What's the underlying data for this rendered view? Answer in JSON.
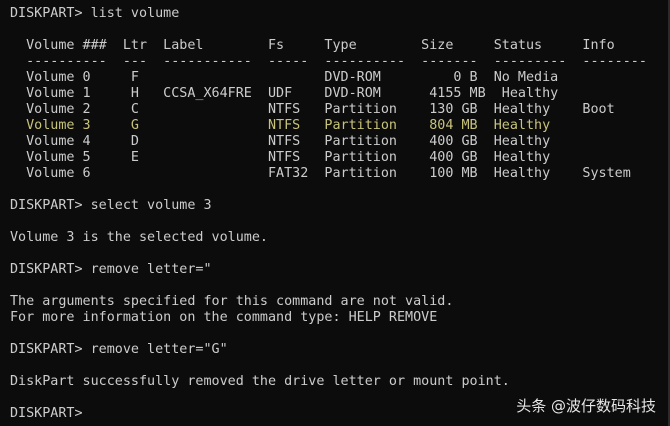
{
  "console": {
    "lines": [
      "DISKPART> list volume",
      "",
      "  Volume ###  Ltr  Label        Fs     Type        Size     Status     Info",
      "  ----------  ---  -----------  -----  ----------  -------  ---------  --------",
      "  Volume 0     F                       DVD-ROM         0 B  No Media",
      "  Volume 1     H   CCSA_X64FRE  UDF    DVD-ROM      4155 MB  Healthy",
      "  Volume 2     C                NTFS   Partition    130 GB  Healthy    Boot",
      "  Volume 3     G                NTFS   Partition    804 MB  Healthy",
      "  Volume 4     D                NTFS   Partition    400 GB  Healthy",
      "  Volume 5     E                NTFS   Partition    400 GB  Healthy",
      "  Volume 6                      FAT32  Partition    100 MB  Healthy    System",
      "",
      "DISKPART> select volume 3",
      "",
      "Volume 3 is the selected volume.",
      "",
      "DISKPART> remove letter=\"",
      "",
      "The arguments specified for this command are not valid.",
      "For more information on the command type: HELP REMOVE",
      "",
      "DISKPART> remove letter=\"G\"",
      "",
      "DiskPart successfully removed the drive letter or mount point.",
      "",
      "DISKPART>"
    ],
    "highlight_line_index": 7
  },
  "watermark": {
    "text": "头条 @波仔数码科技"
  }
}
